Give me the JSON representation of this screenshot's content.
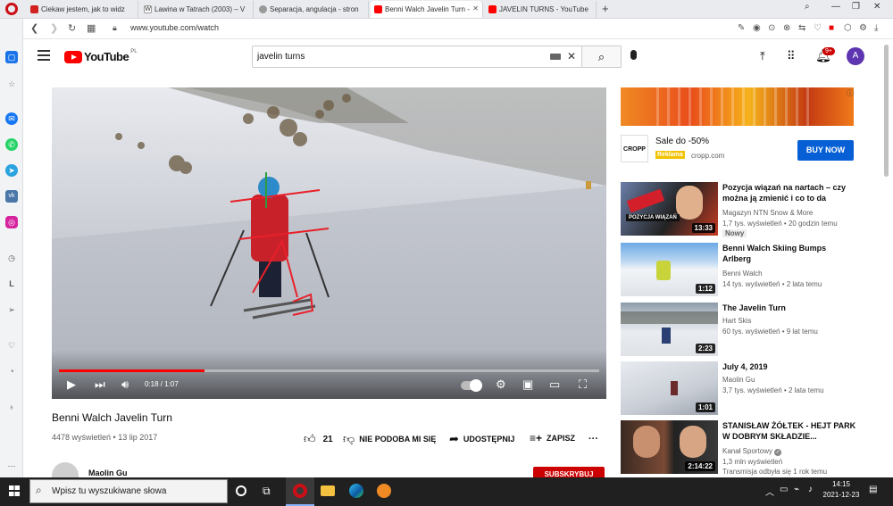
{
  "browser": {
    "tabs": [
      {
        "label": "Ciekaw jestem, jak to widz",
        "active": false
      },
      {
        "label": "Lawina w Tatrach (2003) – V",
        "active": false
      },
      {
        "label": "Separacja, angulacja - stron",
        "active": false
      },
      {
        "label": "Benni Walch Javelin Turn -",
        "active": true
      },
      {
        "label": "JAVELIN TURNS - YouTube",
        "active": false
      }
    ],
    "new_tab_label": "+",
    "url": "www.youtube.com/watch"
  },
  "youtube": {
    "logo_text": "YouTube",
    "logo_region": "PL",
    "search_value": "javelin turns",
    "notification_count": "9+",
    "avatar_letter": "A"
  },
  "player": {
    "time": "0:18 / 1:07",
    "progress_fraction": 0.27
  },
  "video": {
    "title": "Benni Walch Javelin Turn",
    "views": "4478 wyświetleń",
    "date": "13 lip 2017",
    "likes": "21",
    "dislike_label": "NIE PODOBA MI SIĘ",
    "share_label": "UDOSTĘPNIJ",
    "save_label": "ZAPISZ",
    "more_label": "···",
    "channel": "Maolin Gu",
    "subscribe_label": "SUBSKRYBUJ"
  },
  "ad": {
    "brand_logo": "CROPP",
    "title": "Sale do -50%",
    "badge": "Reklama",
    "domain": "cropp.com",
    "cta": "BUY NOW"
  },
  "recommendations": [
    {
      "title": "Pozycja wiązań na nartach – czy można ją zmienić i co to da",
      "channel": "Magazyn NTN Snow & More",
      "meta": "1,7 tys. wyświetleń • 20 godzin temu",
      "badge": "Nowy",
      "duration": "13:33",
      "thumb_caption": "POZYCJA WIĄZAŃ"
    },
    {
      "title": "Benni Walch Skiing Bumps Arlberg",
      "channel": "Benni Walch",
      "meta": "14 tys. wyświetleń • 2 lata temu",
      "duration": "1:12"
    },
    {
      "title": "The Javelin Turn",
      "channel": "Hart Skis",
      "meta": "60 tys. wyświetleń • 9 lat temu",
      "duration": "2:23"
    },
    {
      "title": "July 4, 2019",
      "channel": "Maolin Gu",
      "meta": "3,7 tys. wyświetleń • 2 lata temu",
      "duration": "1:01"
    },
    {
      "title": "STANISŁAW ŻÓŁTEK - HEJT PARK W DOBRYM SKŁADZIE...",
      "channel": "Kanał Sportowy",
      "meta": "1,3 mln wyświetleń",
      "meta2": "Transmisja odbyła się 1 rok temu",
      "duration": "2:14:22"
    }
  ],
  "taskbar": {
    "search_placeholder": "Wpisz tu wyszukiwane słowa",
    "time": "14:15",
    "date": "2021-12-23"
  },
  "colors": {
    "youtube_red": "#ff0000",
    "cta_blue": "#065fd4",
    "opera_red": "#cc0f16"
  }
}
